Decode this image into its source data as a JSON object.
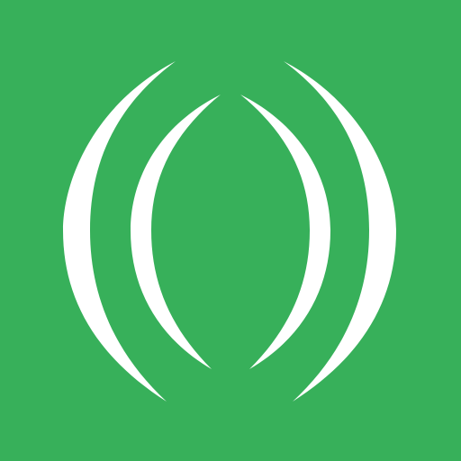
{
  "logo": {
    "icon": "nested-arcs-logo-icon",
    "background_color": "#37B05A",
    "foreground_color": "#FFFFFF"
  }
}
